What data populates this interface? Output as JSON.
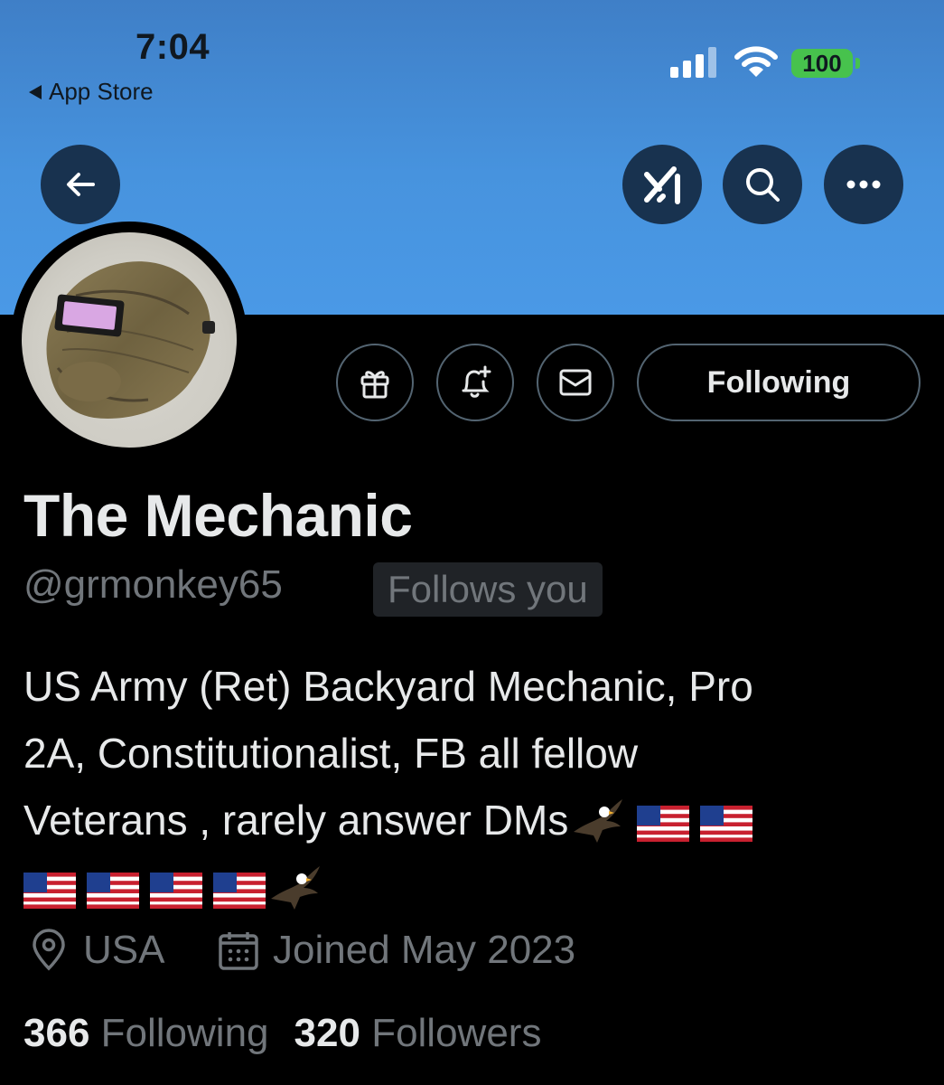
{
  "status_bar": {
    "time": "7:04",
    "back_app": "App Store",
    "battery": "100"
  },
  "header": {
    "back_icon": "arrow-left-icon",
    "grok_icon": "grok-icon",
    "search_icon": "search-icon",
    "more_icon": "more-horizontal-icon"
  },
  "actions": {
    "subscribe_icon": "gift-icon",
    "notify_icon": "bell-plus-icon",
    "message_icon": "envelope-icon",
    "following_label": "Following"
  },
  "profile": {
    "name": "The Mechanic",
    "handle": "@grmonkey65",
    "follows_you": "Follows you",
    "bio_lines": [
      "US Army (Ret) Backyard Mechanic, Pro",
      "2A, Constitutionalist, FB all fellow",
      "Veterans , rarely answer DMs"
    ],
    "location": "USA",
    "joined": "Joined May 2023",
    "following_count": "366",
    "following_label": "Following",
    "followers_count": "320",
    "followers_label": "Followers"
  },
  "colors": {
    "banner": "#4793de",
    "accent_green": "#47c24d",
    "muted": "#71767b"
  }
}
